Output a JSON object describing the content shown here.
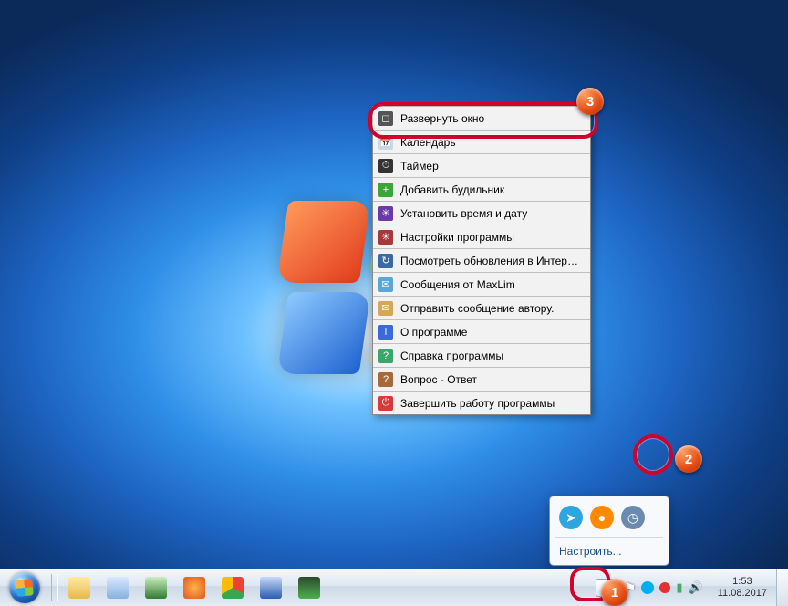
{
  "context_menu": {
    "items": [
      {
        "label": "Развернуть окно",
        "icon_bg": "#555",
        "glyph": "◻"
      },
      {
        "label": "Календарь",
        "icon_bg": "#c8d8e8",
        "glyph": "📅"
      },
      {
        "label": "Таймер",
        "icon_bg": "#333",
        "glyph": "⏱"
      },
      {
        "label": "Добавить будильник",
        "icon_bg": "#3aa63a",
        "glyph": "+"
      },
      {
        "label": "Установить время и дату",
        "icon_bg": "#6a3aa6",
        "glyph": "✳"
      },
      {
        "label": "Настройки программы",
        "icon_bg": "#a63a3a",
        "glyph": "✳"
      },
      {
        "label": "Посмотреть обновления в Интернете",
        "icon_bg": "#3a6aa6",
        "glyph": "↻"
      },
      {
        "label": "Сообщения от MaxLim",
        "icon_bg": "#5aa6d6",
        "glyph": "✉"
      },
      {
        "label": "Отправить сообщение автору.",
        "icon_bg": "#d6a65a",
        "glyph": "✉"
      },
      {
        "label": "О программе",
        "icon_bg": "#3a6ad6",
        "glyph": "i"
      },
      {
        "label": "Справка программы",
        "icon_bg": "#3aa66a",
        "glyph": "?"
      },
      {
        "label": "Вопрос - Ответ",
        "icon_bg": "#a66a3a",
        "glyph": "?"
      },
      {
        "label": "Завершить работу программы",
        "icon_bg": "#d63a3a",
        "glyph": "⏻"
      }
    ]
  },
  "tray_popup": {
    "icons": [
      {
        "name": "telegram-icon",
        "bg": "#2da5df",
        "glyph": "➤"
      },
      {
        "name": "avast-icon",
        "bg": "#ff8a00",
        "glyph": "●"
      },
      {
        "name": "clock-app-icon",
        "bg": "#6a8ab0",
        "glyph": "◷"
      }
    ],
    "configure_label": "Настроить..."
  },
  "taskbar": {
    "pinned": [
      {
        "name": "explorer-icon",
        "bg": "linear-gradient(#ffe9a8,#e8b84a)"
      },
      {
        "name": "notepad-icon",
        "bg": "linear-gradient(#d8e8ff,#88b0e0)"
      },
      {
        "name": "excel-icon",
        "bg": "linear-gradient(#cdeec0,#2f7d32)"
      },
      {
        "name": "firefox-icon",
        "bg": "radial-gradient(circle,#ffb34a,#e0551e)"
      },
      {
        "name": "chrome-icon",
        "bg": "conic-gradient(#ea4335 0 33%,#34a853 0 66%,#fbbc05 0)"
      },
      {
        "name": "word-icon",
        "bg": "linear-gradient(#c8d8f8,#2a5db0)"
      },
      {
        "name": "taskmgr-icon",
        "bg": "linear-gradient(#2a4a2a,#4fae4f)"
      }
    ],
    "tray_arrow_glyph": "▲",
    "clock_time": "1:53",
    "clock_date": "11.08.2017"
  },
  "markers": {
    "1": "1",
    "2": "2",
    "3": "3"
  }
}
